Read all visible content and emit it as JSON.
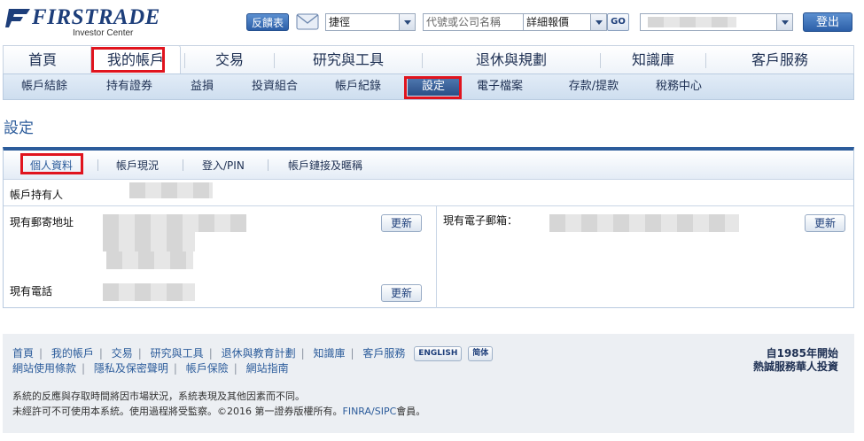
{
  "header": {
    "logo_text": "FIRSTRADE",
    "logo_sub": "Investor Center",
    "feedback_label": "反饋表",
    "shortcut_select": "捷徑",
    "symbol_placeholder": "代號或公司名稱",
    "quote_select": "詳細報價",
    "go_label": "GO",
    "logout_label": "登出"
  },
  "nav": {
    "main": [
      "首頁",
      "我的帳戶",
      "交易",
      "研究與工具",
      "退休與規劃",
      "知識庫",
      "客戶服務"
    ],
    "main_active": "我的帳戶",
    "sub": [
      "帳戶結餘",
      "持有證券",
      "益損",
      "投資組合",
      "帳戶紀錄",
      "設定",
      "電子檔案",
      "存款/提款",
      "稅務中心"
    ],
    "sub_active": "設定"
  },
  "page": {
    "title": "設定",
    "tabs": [
      "個人資料",
      "帳戶現況",
      "登入/PIN",
      "帳戶鏈接及暱稱"
    ],
    "active_tab": "個人資料",
    "holder_label": "帳戶持有人",
    "address_label": "現有郵寄地址",
    "phone_label": "現有電話",
    "email_label": "現有電子郵箱：",
    "update_label": "更新"
  },
  "footer": {
    "links_row1": [
      "首頁",
      "我的帳戶",
      "交易",
      "研究與工具",
      "退休與教育計劃",
      "知識庫",
      "客戶服務"
    ],
    "english_label": "ENGLISH",
    "simplified_label": "简体",
    "links_row2": [
      "網站使用條款",
      "隱私及保密聲明",
      "帳戶保險",
      "網站指南"
    ],
    "since_line1": "自1985年開始",
    "since_line2": "熱誠服務華人投資",
    "note1": "系統的反應與存取時間將因市場狀況，系統表現及其他因素而不同。",
    "note2_prefix": "未經許可不可使用本系統。使用過程將受監察。©2016 第一證券版權所有。",
    "note2_link": "FINRA/SIPC",
    "note2_suffix": "會員。"
  },
  "colors": {
    "brand_blue": "#1d3e7a",
    "accent_blue": "#2c5c9b",
    "highlight_red": "#e0141e"
  }
}
